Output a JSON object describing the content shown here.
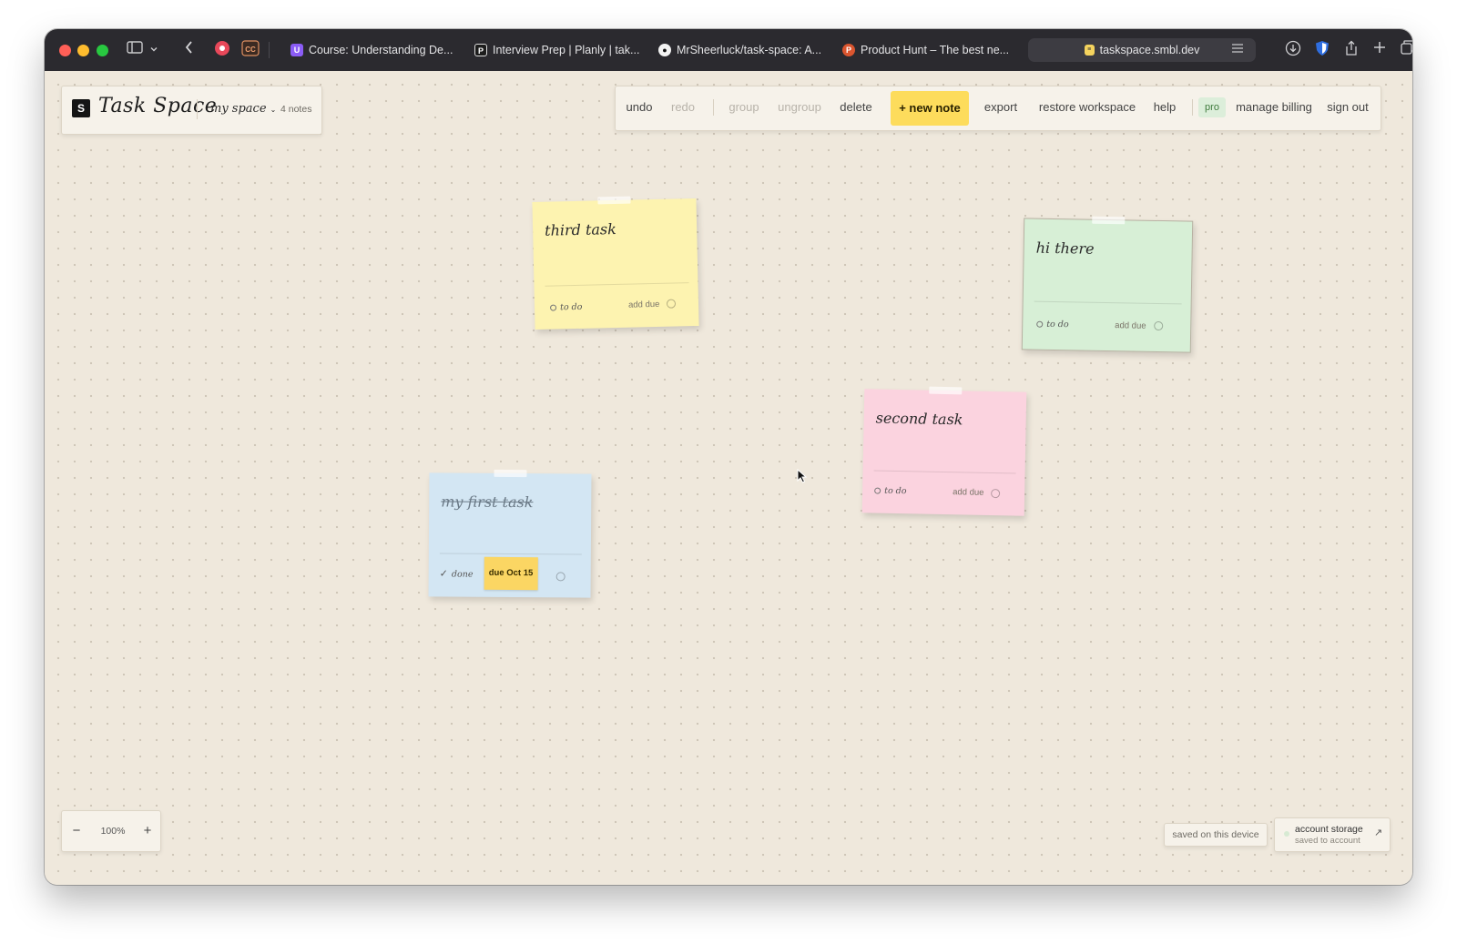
{
  "browser": {
    "tabs": [
      {
        "title": "Course: Understanding De...",
        "favicon": "course-favicon",
        "color": "#8b5cf6"
      },
      {
        "title": "Interview Prep | Planly | tak...",
        "favicon": "planly-favicon",
        "color": "#1c1c1c"
      },
      {
        "title": "MrSheerluck/task-space: A...",
        "favicon": "github-favicon",
        "color": "#1c1c1c"
      },
      {
        "title": "Product Hunt – The best ne...",
        "favicon": "product-hunt-favicon",
        "color": "#da552f"
      }
    ],
    "active_tab": {
      "title": "taskspace.smbl.dev",
      "favicon": "taskspace-favicon"
    }
  },
  "header": {
    "brand": "Task Space",
    "logo_glyph": "S",
    "space": "my space",
    "note_count": "4 notes"
  },
  "toolbar": {
    "undo": "undo",
    "redo": "redo",
    "group": "group",
    "ungroup": "ungroup",
    "delete": "delete",
    "new_note": "+ new note",
    "export": "export",
    "restore": "restore workspace",
    "help": "help",
    "pro": "pro",
    "billing": "manage billing",
    "signout": "sign out"
  },
  "notes": [
    {
      "title": "third task",
      "status": "to do",
      "due": "add due",
      "color": "#fdf3b0"
    },
    {
      "title": "hi there",
      "status": "to do",
      "due": "add due",
      "color": "#d7efd6"
    },
    {
      "title": "second task",
      "status": "to do",
      "due": "add due",
      "color": "#fbd3df"
    },
    {
      "title": "my first task",
      "status": "done",
      "status_icon": "✓",
      "due": "due Oct 15",
      "color": "#d3e6f3"
    }
  ],
  "zoom": {
    "value": "100%",
    "minus": "−",
    "plus": "+"
  },
  "save": {
    "device": "saved on this device",
    "account_title": "account storage",
    "account_sub": "saved to account",
    "account_arrow": "↗"
  }
}
